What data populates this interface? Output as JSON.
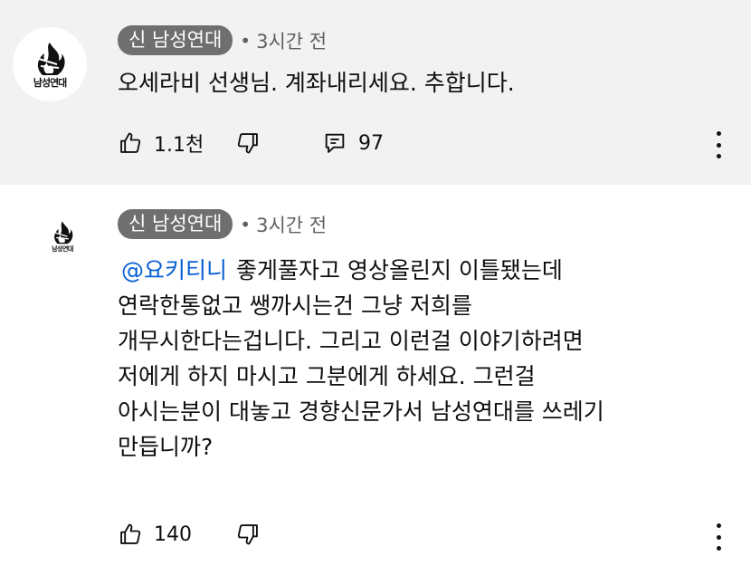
{
  "colors": {
    "chip_bg": "#6f6f6f",
    "mention": "#065fd4",
    "highlight_bg": "#f2f2f2"
  },
  "comments": [
    {
      "author": "신 남성연대",
      "avatar_text": "남성연대",
      "time": "3시간 전",
      "text_lines": [
        "오세라비 선생님. 계좌내리세요. 추합니다."
      ],
      "likes": "1.1천",
      "replies": "97",
      "icons": [
        "thumb-up-icon",
        "thumb-down-icon",
        "reply-icon",
        "more-vert-icon"
      ]
    },
    {
      "author": "신 남성연대",
      "avatar_text": "남성연대",
      "time": "3시간 전",
      "mention": "@요키티니",
      "text_lines": [
        "좋게풀자고 영상올린지 이틀됐는데",
        "연락한통없고 쌩까시는건 그냥 저희를",
        "개무시한다는겁니다. 그리고 이런걸 이야기하려면",
        "저에게 하지 마시고 그분에게 하세요. 그런걸",
        "아시는분이 대놓고 경향신문가서 남성연대를 쓰레기",
        "만듭니까?"
      ],
      "likes": "140",
      "icons": [
        "thumb-up-icon",
        "thumb-down-icon",
        "more-vert-icon"
      ]
    }
  ]
}
